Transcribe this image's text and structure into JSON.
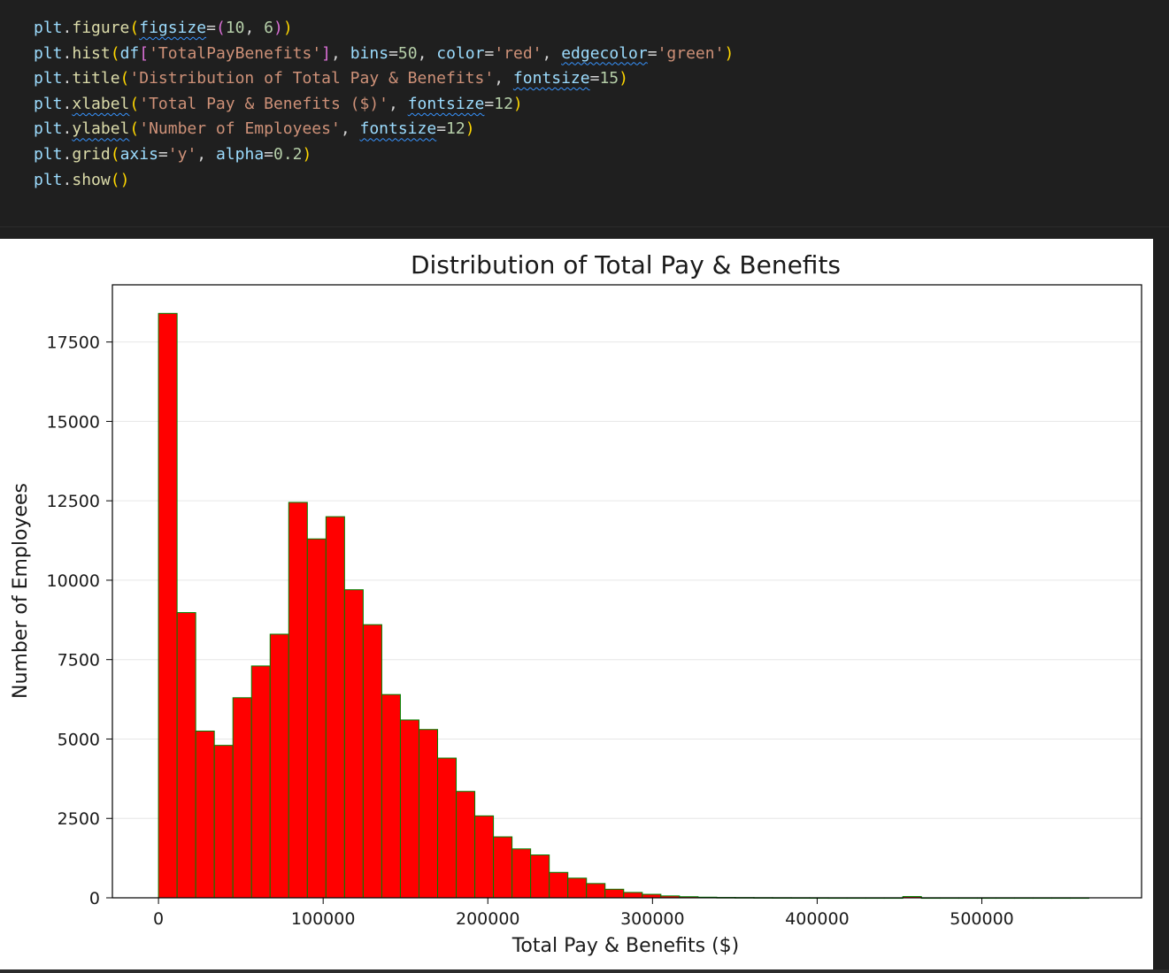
{
  "code_lines": [
    [
      {
        "t": "plt",
        "c": "ident"
      },
      {
        "t": ".",
        "c": "op"
      },
      {
        "t": "figure",
        "c": "func"
      },
      {
        "t": "(",
        "c": "par1"
      },
      {
        "t": "figsize",
        "c": "ident",
        "sq": true
      },
      {
        "t": "=",
        "c": "op"
      },
      {
        "t": "(",
        "c": "par2"
      },
      {
        "t": "10",
        "c": "num"
      },
      {
        "t": ", ",
        "c": "op"
      },
      {
        "t": "6",
        "c": "num"
      },
      {
        "t": ")",
        "c": "par2"
      },
      {
        "t": ")",
        "c": "par1"
      }
    ],
    [
      {
        "t": "plt",
        "c": "ident"
      },
      {
        "t": ".",
        "c": "op"
      },
      {
        "t": "hist",
        "c": "func"
      },
      {
        "t": "(",
        "c": "par1"
      },
      {
        "t": "df",
        "c": "ident"
      },
      {
        "t": "[",
        "c": "par2"
      },
      {
        "t": "'TotalPayBenefits'",
        "c": "str"
      },
      {
        "t": "]",
        "c": "par2"
      },
      {
        "t": ", ",
        "c": "op"
      },
      {
        "t": "bins",
        "c": "ident"
      },
      {
        "t": "=",
        "c": "op"
      },
      {
        "t": "50",
        "c": "num"
      },
      {
        "t": ", ",
        "c": "op"
      },
      {
        "t": "color",
        "c": "ident"
      },
      {
        "t": "=",
        "c": "op"
      },
      {
        "t": "'red'",
        "c": "str"
      },
      {
        "t": ", ",
        "c": "op"
      },
      {
        "t": "edgecolor",
        "c": "ident",
        "sq": true
      },
      {
        "t": "=",
        "c": "op"
      },
      {
        "t": "'green'",
        "c": "str"
      },
      {
        "t": ")",
        "c": "par1"
      }
    ],
    [
      {
        "t": "plt",
        "c": "ident"
      },
      {
        "t": ".",
        "c": "op"
      },
      {
        "t": "title",
        "c": "func"
      },
      {
        "t": "(",
        "c": "par1"
      },
      {
        "t": "'Distribution of Total Pay & Benefits'",
        "c": "str"
      },
      {
        "t": ", ",
        "c": "op"
      },
      {
        "t": "fontsize",
        "c": "ident",
        "sq": true
      },
      {
        "t": "=",
        "c": "op"
      },
      {
        "t": "15",
        "c": "num"
      },
      {
        "t": ")",
        "c": "par1"
      }
    ],
    [
      {
        "t": "plt",
        "c": "ident"
      },
      {
        "t": ".",
        "c": "op"
      },
      {
        "t": "xlabel",
        "c": "func",
        "sq": true
      },
      {
        "t": "(",
        "c": "par1"
      },
      {
        "t": "'Total Pay & Benefits ($)'",
        "c": "str"
      },
      {
        "t": ", ",
        "c": "op"
      },
      {
        "t": "fontsize",
        "c": "ident",
        "sq": true
      },
      {
        "t": "=",
        "c": "op"
      },
      {
        "t": "12",
        "c": "num"
      },
      {
        "t": ")",
        "c": "par1"
      }
    ],
    [
      {
        "t": "plt",
        "c": "ident"
      },
      {
        "t": ".",
        "c": "op"
      },
      {
        "t": "ylabel",
        "c": "func",
        "sq": true
      },
      {
        "t": "(",
        "c": "par1"
      },
      {
        "t": "'Number of Employees'",
        "c": "str"
      },
      {
        "t": ", ",
        "c": "op"
      },
      {
        "t": "fontsize",
        "c": "ident",
        "sq": true
      },
      {
        "t": "=",
        "c": "op"
      },
      {
        "t": "12",
        "c": "num"
      },
      {
        "t": ")",
        "c": "par1"
      }
    ],
    [
      {
        "t": "plt",
        "c": "ident"
      },
      {
        "t": ".",
        "c": "op"
      },
      {
        "t": "grid",
        "c": "func"
      },
      {
        "t": "(",
        "c": "par1"
      },
      {
        "t": "axis",
        "c": "ident"
      },
      {
        "t": "=",
        "c": "op"
      },
      {
        "t": "'y'",
        "c": "str"
      },
      {
        "t": ", ",
        "c": "op"
      },
      {
        "t": "alpha",
        "c": "ident"
      },
      {
        "t": "=",
        "c": "op"
      },
      {
        "t": "0.2",
        "c": "num"
      },
      {
        "t": ")",
        "c": "par1"
      }
    ],
    [
      {
        "t": "plt",
        "c": "ident"
      },
      {
        "t": ".",
        "c": "op"
      },
      {
        "t": "show",
        "c": "func"
      },
      {
        "t": "(",
        "c": "par1"
      },
      {
        "t": ")",
        "c": "par1"
      }
    ]
  ],
  "colors": {
    "bar_fill": "#ff0000",
    "bar_edge": "#008000",
    "grid": "#e6e6e6",
    "text": "#1a1a1a"
  },
  "chart_data": {
    "type": "bar",
    "title": "Distribution of Total Pay & Benefits",
    "xlabel": "Total Pay & Benefits ($)",
    "ylabel": "Number of Employees",
    "bin_start": 0,
    "bin_width": 11300,
    "values": [
      18400,
      8980,
      5250,
      4800,
      6300,
      7300,
      8300,
      12450,
      11300,
      12000,
      9700,
      8600,
      6400,
      5600,
      5300,
      4400,
      3350,
      2580,
      1920,
      1540,
      1350,
      800,
      620,
      450,
      270,
      170,
      110,
      60,
      35,
      20,
      12,
      9,
      6,
      4,
      3,
      2,
      1,
      1,
      1,
      1,
      40,
      1,
      1,
      1,
      1,
      1,
      1,
      1,
      1,
      1
    ],
    "xlim": [
      -28000,
      597000
    ],
    "ylim": [
      0,
      19300
    ],
    "xticks": [
      0,
      100000,
      200000,
      300000,
      400000,
      500000
    ],
    "xtick_labels": [
      "0",
      "100000",
      "200000",
      "300000",
      "400000",
      "500000"
    ],
    "yticks": [
      0,
      2500,
      5000,
      7500,
      10000,
      12500,
      15000,
      17500
    ],
    "ytick_labels": [
      "0",
      "2500",
      "5000",
      "7500",
      "10000",
      "12500",
      "15000",
      "17500"
    ],
    "grid": "y",
    "grid_alpha": 0.2
  }
}
